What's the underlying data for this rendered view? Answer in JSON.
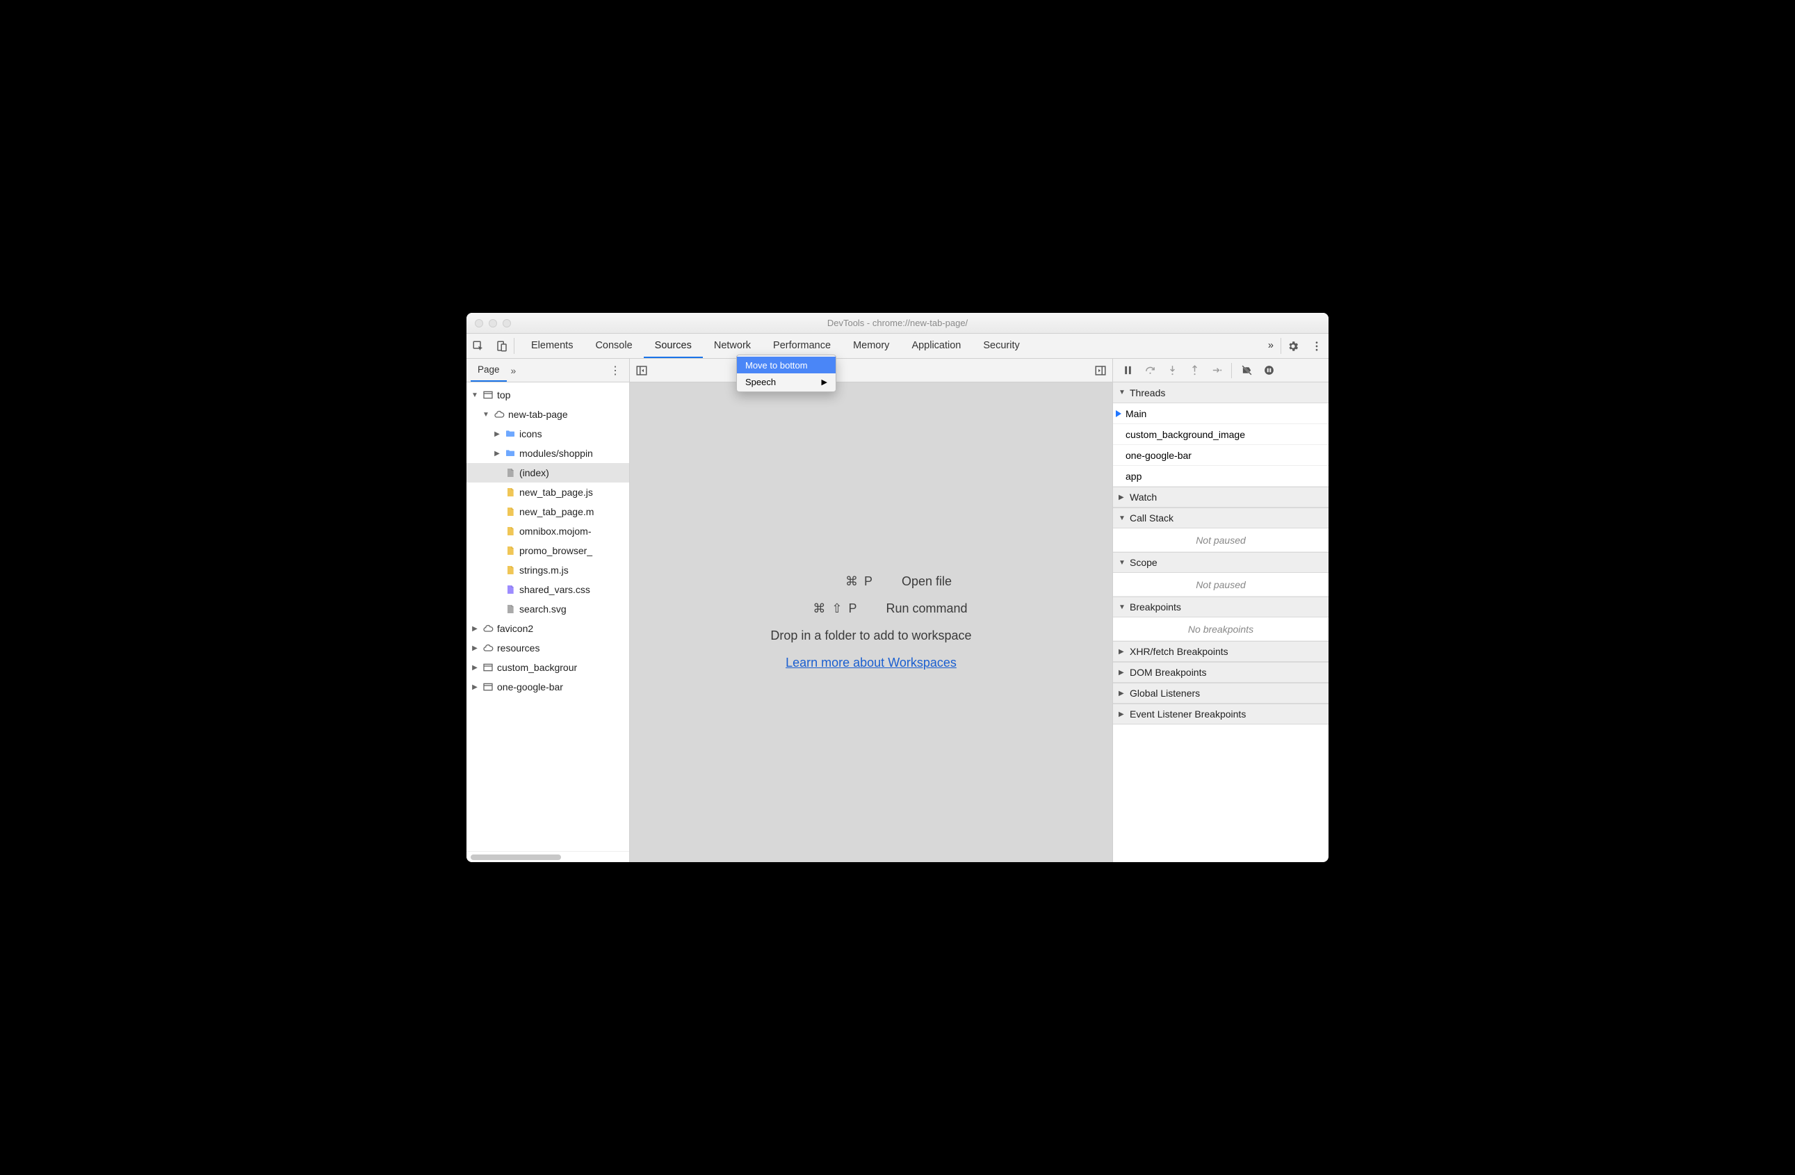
{
  "window": {
    "title": "DevTools - chrome://new-tab-page/"
  },
  "tabs": {
    "items": [
      "Elements",
      "Console",
      "Sources",
      "Network",
      "Performance",
      "Memory",
      "Application",
      "Security"
    ],
    "active": 2,
    "more": "»"
  },
  "contextMenu": {
    "items": [
      {
        "label": "Move to bottom",
        "highlighted": true,
        "submenu": false
      },
      {
        "label": "Speech",
        "highlighted": false,
        "submenu": true
      }
    ]
  },
  "leftPanel": {
    "tab": "Page",
    "more": "»",
    "tree": [
      {
        "depth": 0,
        "arrow": "▼",
        "icon": "frame",
        "label": "top"
      },
      {
        "depth": 1,
        "arrow": "▼",
        "icon": "cloud",
        "label": "new-tab-page"
      },
      {
        "depth": 2,
        "arrow": "▶",
        "icon": "folder",
        "label": "icons"
      },
      {
        "depth": 2,
        "arrow": "▶",
        "icon": "folder",
        "label": "modules/shoppin"
      },
      {
        "depth": 2,
        "arrow": "",
        "icon": "doc",
        "label": "(index)",
        "selected": true
      },
      {
        "depth": 2,
        "arrow": "",
        "icon": "js",
        "label": "new_tab_page.js"
      },
      {
        "depth": 2,
        "arrow": "",
        "icon": "js",
        "label": "new_tab_page.m"
      },
      {
        "depth": 2,
        "arrow": "",
        "icon": "js",
        "label": "omnibox.mojom-"
      },
      {
        "depth": 2,
        "arrow": "",
        "icon": "js",
        "label": "promo_browser_"
      },
      {
        "depth": 2,
        "arrow": "",
        "icon": "js",
        "label": "strings.m.js"
      },
      {
        "depth": 2,
        "arrow": "",
        "icon": "css",
        "label": "shared_vars.css"
      },
      {
        "depth": 2,
        "arrow": "",
        "icon": "doc",
        "label": "search.svg"
      },
      {
        "depth": 0,
        "arrow": "▶",
        "icon": "cloud",
        "label": "favicon2"
      },
      {
        "depth": 0,
        "arrow": "▶",
        "icon": "cloud",
        "label": "resources"
      },
      {
        "depth": 0,
        "arrow": "▶",
        "icon": "frame",
        "label": "custom_backgrour"
      },
      {
        "depth": 0,
        "arrow": "▶",
        "icon": "frame",
        "label": "one-google-bar"
      }
    ]
  },
  "center": {
    "openFile": {
      "keys": "⌘ P",
      "label": "Open file"
    },
    "runCmd": {
      "keys": "⌘ ⇧ P",
      "label": "Run command"
    },
    "dropHint": "Drop in a folder to add to workspace",
    "learnMore": "Learn more about Workspaces"
  },
  "right": {
    "threadsHeader": "Threads",
    "threads": [
      "Main",
      "custom_background_image",
      "one-google-bar",
      "app"
    ],
    "watch": "Watch",
    "callStack": "Call Stack",
    "notPaused": "Not paused",
    "scope": "Scope",
    "breakpoints": "Breakpoints",
    "noBreakpoints": "No breakpoints",
    "xhr": "XHR/fetch Breakpoints",
    "dom": "DOM Breakpoints",
    "global": "Global Listeners",
    "event": "Event Listener Breakpoints"
  }
}
